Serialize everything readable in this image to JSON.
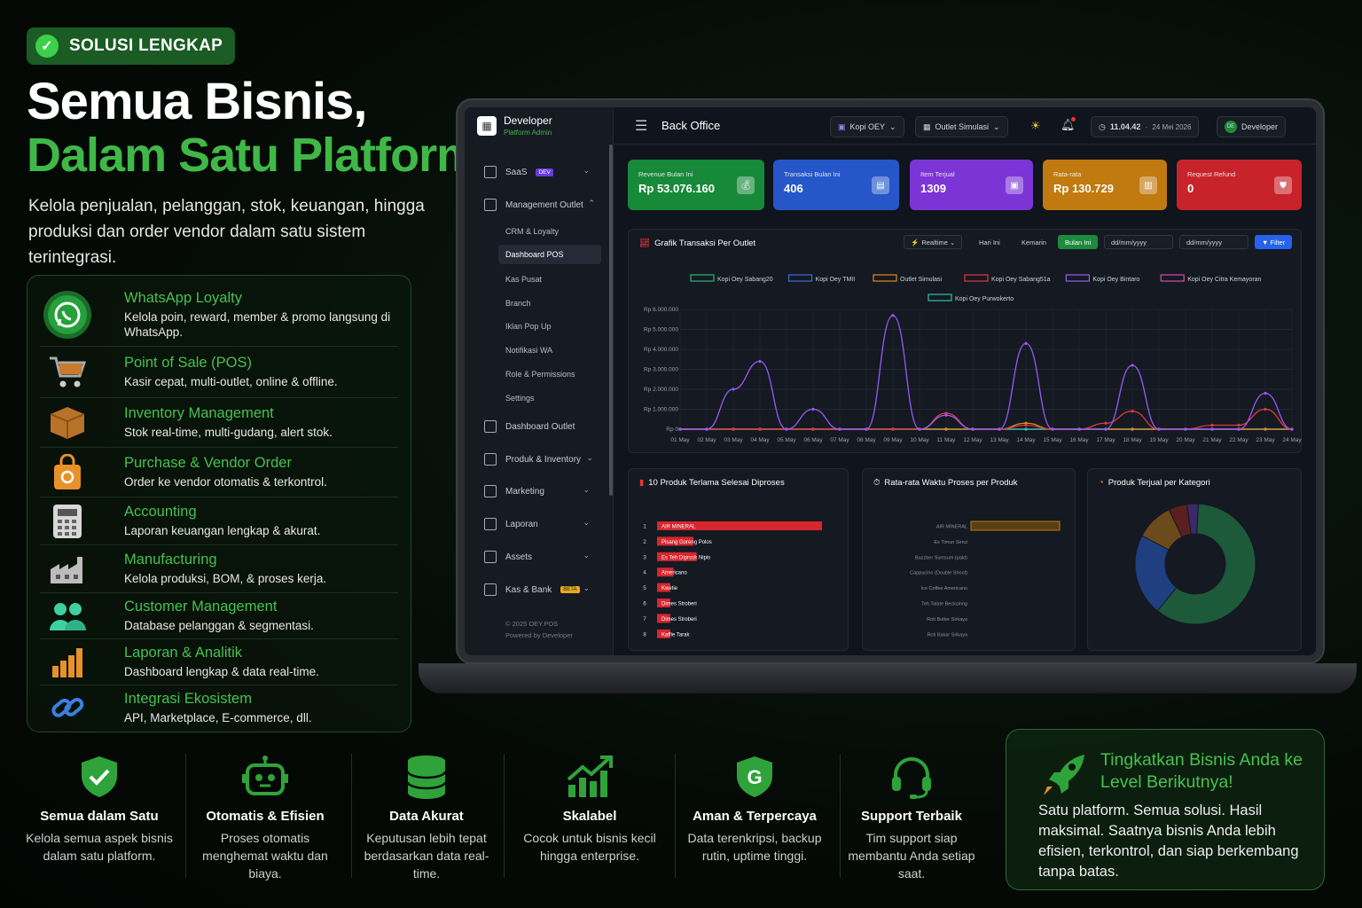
{
  "hero": {
    "badge": "SOLUSI LENGKAP",
    "title_line1": "Semua Bisnis,",
    "title_line2": "Dalam Satu Platform",
    "lead": "Kelola penjualan, pelanggan, stok, keuangan, hingga produksi dan order vendor dalam satu sistem terintegrasi."
  },
  "features": [
    {
      "title": "WhatsApp Loyalty",
      "desc": "Kelola poin, reward, member & promo langsung di WhatsApp.",
      "icon": "whatsapp-icon"
    },
    {
      "title": "Point of Sale (POS)",
      "desc": "Kasir cepat, multi-outlet, online & offline.",
      "icon": "cart-icon"
    },
    {
      "title": "Inventory Management",
      "desc": "Stok real-time, multi-gudang, alert stok.",
      "icon": "box-icon"
    },
    {
      "title": "Purchase & Vendor Order",
      "desc": "Order ke vendor otomatis & terkontrol.",
      "icon": "shopping-bag-icon"
    },
    {
      "title": "Accounting",
      "desc": "Laporan keuangan lengkap & akurat.",
      "icon": "calculator-icon"
    },
    {
      "title": "Manufacturing",
      "desc": "Kelola produksi, BOM, & proses kerja.",
      "icon": "factory-icon"
    },
    {
      "title": "Customer Management",
      "desc": "Database pelanggan & segmentasi.",
      "icon": "users-icon"
    },
    {
      "title": "Laporan & Analitik",
      "desc": "Dashboard lengkap & data real-time.",
      "icon": "bar-chart-icon"
    },
    {
      "title": "Integrasi Ekosistem",
      "desc": "API, Marketplace, E-commerce, dll.",
      "icon": "link-icon"
    }
  ],
  "benefits": [
    {
      "title": "Semua dalam Satu",
      "desc": "Kelola semua aspek bisnis dalam satu platform.",
      "icon": "shield-check-icon"
    },
    {
      "title": "Otomatis & Efisien",
      "desc": "Proses otomatis menghemat waktu dan biaya.",
      "icon": "robot-icon"
    },
    {
      "title": "Data Akurat",
      "desc": "Keputusan lebih tepat berdasarkan data real-time.",
      "icon": "database-icon"
    },
    {
      "title": "Skalabel",
      "desc": "Cocok untuk bisnis kecil hingga enterprise.",
      "icon": "growth-chart-icon"
    },
    {
      "title": "Aman & Terpercaya",
      "desc": "Data terenkripsi, backup rutin, uptime tinggi.",
      "icon": "shield-g-icon"
    },
    {
      "title": "Support Terbaik",
      "desc": "Tim support siap membantu Anda setiap saat.",
      "icon": "headset-icon"
    }
  ],
  "cta": {
    "title": "Tingkatkan Bisnis Anda ke Level Berikutnya!",
    "desc": "Satu platform. Semua solusi. Hasil maksimal. Saatnya bisnis Anda lebih efisien, terkontrol, dan siap berkembang tanpa batas."
  },
  "app": {
    "user": "Developer",
    "role": "Platform Admin",
    "page_title": "Back Office",
    "brand_select": "Kopi OEY",
    "outlet_select": "Outlet Simulasi",
    "time": "11.04.42",
    "date": "24 Mei 2026",
    "profile": "Developer",
    "profile_initials": "DE",
    "footer_copy": "© 2025 OEY.POS",
    "footer_powered": "Powered by Developer",
    "sidebar": [
      {
        "label": "SaaS",
        "badge": "DEV",
        "chevron": "⌄"
      },
      {
        "label": "Management Outlet",
        "chevron": "⌃"
      },
      {
        "label": "Dashboard Outlet"
      },
      {
        "label": "Produk & Inventory",
        "chevron": "⌄"
      },
      {
        "label": "Marketing",
        "chevron": "⌄"
      },
      {
        "label": "Laporan",
        "chevron": "⌄"
      },
      {
        "label": "Assets",
        "chevron": "⌄"
      },
      {
        "label": "Kas & Bank",
        "badge": "BETA",
        "chevron": "⌄"
      }
    ],
    "submenu": [
      "CRM & Loyalty",
      "Dashboard POS",
      "Kas Pusat",
      "Branch",
      "Iklan Pop Up",
      "Notifikasi WA",
      "Role & Permissions",
      "Settings"
    ],
    "cards": [
      {
        "label": "Revenue Bulan Ini",
        "value": "Rp 53.076.160",
        "color": "#178a3a"
      },
      {
        "label": "Transaksi Bulan Ini",
        "value": "406",
        "color": "#2657c9"
      },
      {
        "label": "Item Terjual",
        "value": "1309",
        "color": "#7b35d6"
      },
      {
        "label": "Rata-rata",
        "value": "Rp 130.729",
        "color": "#c07a10"
      },
      {
        "label": "Request Refund",
        "value": "0",
        "color": "#c8232b"
      }
    ],
    "chart_controls": {
      "realtime": "Realtime",
      "today": "Hari Ini",
      "yesterday": "Kemarin",
      "this_month": "Bulan Ini",
      "date_from": "dd/mm/yyyy",
      "date_to": "dd/mm/yyyy",
      "filter": "Filter"
    },
    "panels": {
      "top_products": "10 Produk Terlama Selesai Diproses",
      "avg_time": "Rata-rata Waktu Proses per Produk",
      "category": "Produk Terjual per Kategori"
    }
  },
  "chart_data": [
    {
      "type": "line",
      "title": "Grafik Transaksi Per Outlet",
      "categories": [
        "01 May",
        "02 May",
        "03 May",
        "04 May",
        "05 May",
        "06 May",
        "07 May",
        "08 May",
        "09 May",
        "10 May",
        "11 May",
        "12 May",
        "13 May",
        "14 May",
        "15 May",
        "16 May",
        "17 May",
        "18 May",
        "19 May",
        "20 May",
        "21 May",
        "22 May",
        "23 May",
        "24 May"
      ],
      "yticks": [
        "Rp 0",
        "Rp 1.000.000",
        "Rp 2.000.000",
        "Rp 3.000.000",
        "Rp 4.000.000",
        "Rp 5.000.000",
        "Rp 6.000.000"
      ],
      "ylim": [
        0,
        6000000
      ],
      "series": [
        {
          "name": "Kopi Oey Sabang20",
          "color": "#2bb673",
          "values": [
            0,
            0,
            0,
            0,
            0,
            0,
            0,
            0,
            0,
            0,
            0,
            0,
            0,
            0,
            0,
            0,
            0,
            0,
            0,
            0,
            0,
            0,
            0,
            0
          ]
        },
        {
          "name": "Kopi Oey TMII",
          "color": "#3b6fd8",
          "values": [
            0,
            0,
            0,
            0,
            0,
            0,
            0,
            0,
            0,
            0,
            0,
            0,
            0,
            0,
            0,
            0,
            0,
            0,
            0,
            0,
            0,
            0,
            0,
            0
          ]
        },
        {
          "name": "Outlet Simulasi",
          "color": "#e08a1e",
          "values": [
            0,
            0,
            0,
            0,
            0,
            0,
            0,
            0,
            0,
            0,
            0,
            0,
            0,
            300000,
            0,
            0,
            0,
            0,
            0,
            0,
            0,
            0,
            0,
            0
          ]
        },
        {
          "name": "Kopi Oey Sabang51a",
          "color": "#e03a3a",
          "values": [
            0,
            0,
            0,
            0,
            0,
            0,
            0,
            0,
            0,
            0,
            800000,
            0,
            0,
            200000,
            0,
            0,
            300000,
            900000,
            0,
            0,
            200000,
            200000,
            1000000,
            0
          ]
        },
        {
          "name": "Kopi Oey Bintaro",
          "color": "#9b59f6",
          "values": [
            0,
            0,
            2000000,
            3400000,
            0,
            1000000,
            0,
            0,
            5700000,
            0,
            700000,
            0,
            0,
            4300000,
            0,
            0,
            0,
            3200000,
            0,
            0,
            0,
            0,
            1800000,
            0
          ]
        },
        {
          "name": "Kopi Oey Citra Kemayoran",
          "color": "#d94ca8",
          "values": [
            0,
            0,
            0,
            0,
            0,
            0,
            0,
            0,
            0,
            0,
            0,
            0,
            0,
            0,
            0,
            0,
            0,
            0,
            0,
            0,
            0,
            0,
            0,
            0
          ]
        },
        {
          "name": "Kopi Oey Purwokerto",
          "color": "#2bc4a8",
          "values": [
            0,
            0,
            0,
            0,
            0,
            0,
            0,
            0,
            0,
            0,
            0,
            0,
            0,
            0,
            0,
            0,
            0,
            0,
            0,
            0,
            0,
            0,
            0,
            0
          ]
        }
      ]
    },
    {
      "type": "bar",
      "title": "10 Produk Terlama Selesai Diproses",
      "ranks": [
        "1",
        "2",
        "3",
        "4",
        "5",
        "6",
        "7",
        "8"
      ],
      "categories": [
        "AIR MINERAL",
        "Pisang Goreng Polos",
        "Es Teh Diprock Nipis",
        "Americano",
        "Kwetie",
        "Dimes Stroberi",
        "Dimes Stroberi",
        "Kaffie Tarak"
      ],
      "values": [
        100,
        22,
        24,
        10,
        8,
        8,
        8,
        8
      ]
    },
    {
      "type": "bar",
      "title": "Rata-rata Waktu Proses per Produk",
      "categories": [
        "AIR MINERAL",
        "Es Timun Serut",
        "Bazzber Sumsum (pakt)",
        "Cappucino (Double Shoot)",
        "Ice Coffee Americano",
        "Teh Talate Becksinng",
        "Roti Butter Srikaya",
        "Roti Bakar Srikaya"
      ],
      "values": [
        100,
        0,
        0,
        0,
        0,
        0,
        0,
        0
      ]
    },
    {
      "type": "pie",
      "title": "Produk Terjual per Kategori",
      "values": [
        60,
        22,
        10,
        5,
        3
      ],
      "colors": [
        "#1d5a3a",
        "#1f3f80",
        "#6b4a1c",
        "#5a2020",
        "#3a2a6a"
      ]
    }
  ]
}
